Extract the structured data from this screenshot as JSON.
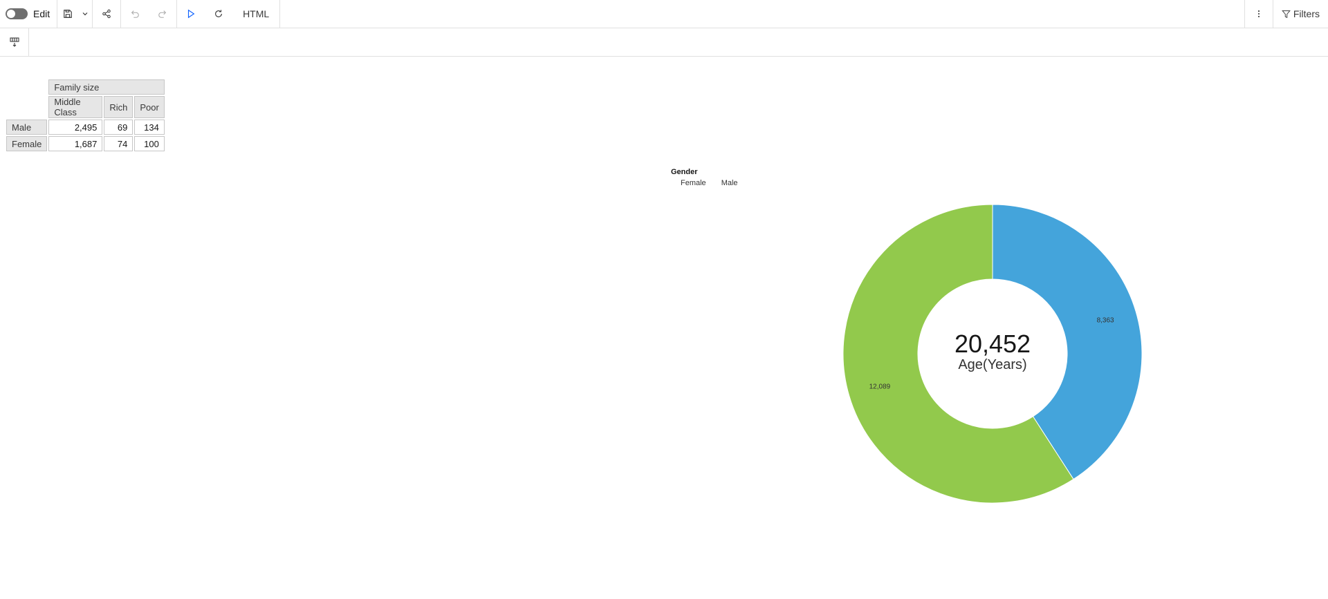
{
  "toolbar": {
    "edit_label": "Edit",
    "html_label": "HTML",
    "filters_label": "Filters",
    "icons": [
      "toggle-icon",
      "save-icon",
      "chevron-down-icon",
      "share-icon",
      "undo-icon",
      "redo-icon",
      "play-icon",
      "refresh-icon",
      "more-vertical-icon",
      "filter-icon"
    ]
  },
  "subbar": {
    "icon": "insert-data-icon"
  },
  "crosstab": {
    "group_header": "Family size",
    "columns": [
      "Middle Class",
      "Rich",
      "Poor"
    ],
    "rows": [
      {
        "label": "Male",
        "values": [
          "2,495",
          "69",
          "134"
        ]
      },
      {
        "label": "Female",
        "values": [
          "1,687",
          "74",
          "100"
        ]
      }
    ]
  },
  "legend": {
    "title": "Gender",
    "items": [
      "Female",
      "Male"
    ]
  },
  "chart_data": {
    "type": "pie",
    "donut": true,
    "center_value": "20,452",
    "center_label": "Age(Years)",
    "slices": [
      {
        "name": "Male",
        "value": 8363,
        "label": "8,363",
        "color": "#44a4db"
      },
      {
        "name": "Female",
        "value": 12089,
        "label": "12,089",
        "color": "#92c94c"
      }
    ]
  }
}
